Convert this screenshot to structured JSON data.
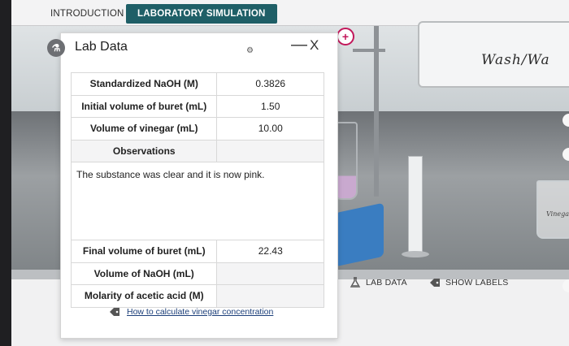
{
  "tabs": [
    {
      "label": "INTRODUCTION",
      "active": false
    },
    {
      "label": "LABORATORY SIMULATION",
      "active": true
    }
  ],
  "scene": {
    "wash_label": "Wash/Wa",
    "beaker_label": "Vinega"
  },
  "controls": {
    "lab_data_label": "LAB DATA",
    "show_labels_label": "SHOW LABELS"
  },
  "panel": {
    "title": "Lab Data",
    "minimize_glyph": "—",
    "close_glyph": "X",
    "rows": [
      {
        "label": "Standardized NaOH (M)",
        "value": "0.3826"
      },
      {
        "label": "Initial volume of buret (mL)",
        "value": "1.50"
      },
      {
        "label": "Volume of vinegar (mL)",
        "value": "10.00"
      }
    ],
    "observations_label": "Observations",
    "observations_text": "The substance was clear and it is now pink.",
    "results": [
      {
        "label": "Final volume of buret (mL)",
        "value": "22.43"
      },
      {
        "label": "Volume of NaOH (mL)",
        "value": ""
      },
      {
        "label": "Molarity of acetic acid (M)",
        "value": ""
      }
    ],
    "help_link": "How to calculate vinegar concentration"
  },
  "colors": {
    "active_tab": "#1f5f67",
    "link": "#1c3f7a",
    "zoom_accent": "#c2185b",
    "stir_plate": "#3a7dc1"
  },
  "icons": [
    "flask-icon",
    "zoom-in-icon",
    "tag-icon",
    "chevron-tag-icon"
  ]
}
